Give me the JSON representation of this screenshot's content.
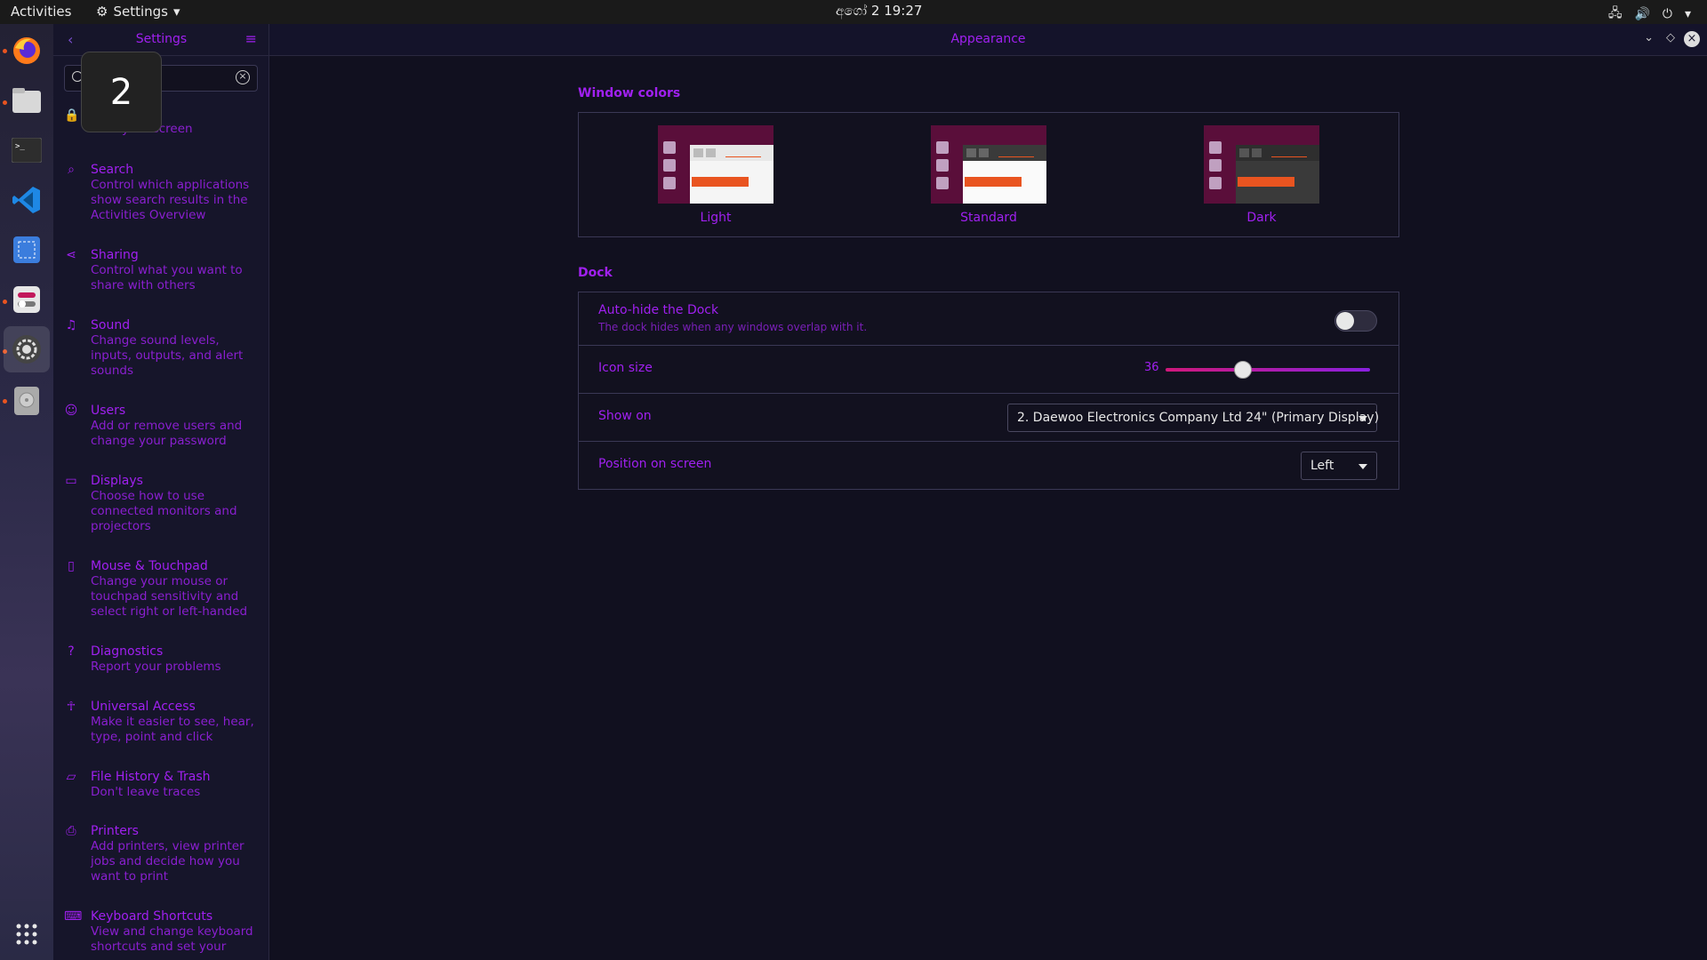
{
  "topbar": {
    "activities": "Activities",
    "app_menu": "Settings",
    "clock": "අගෝ  2  19:27"
  },
  "overlay": {
    "number": "2"
  },
  "sidebar": {
    "title": "Settings",
    "search_placeholder": "",
    "items": [
      {
        "title": "",
        "desc": "Lock your screen",
        "icon": "lock-icon"
      },
      {
        "title": "Search",
        "desc": "Control which applications show search results in the Activities Overview",
        "icon": "search-icon"
      },
      {
        "title": "Sharing",
        "desc": "Control what you want to share with others",
        "icon": "share-icon"
      },
      {
        "title": "Sound",
        "desc": "Change sound levels, inputs, outputs, and alert sounds",
        "icon": "music-note-icon"
      },
      {
        "title": "Users",
        "desc": "Add or remove users and change your password",
        "icon": "user-icon"
      },
      {
        "title": "Displays",
        "desc": "Choose how to use connected monitors and projectors",
        "icon": "display-icon"
      },
      {
        "title": "Mouse & Touchpad",
        "desc": "Change your mouse or touchpad sensitivity and select right or left-handed",
        "icon": "mouse-icon"
      },
      {
        "title": "Diagnostics",
        "desc": "Report your problems",
        "icon": "help-icon"
      },
      {
        "title": "Universal Access",
        "desc": "Make it easier to see, hear, type, point and click",
        "icon": "accessibility-icon"
      },
      {
        "title": "File History & Trash",
        "desc": "Don't leave traces",
        "icon": "folder-icon"
      },
      {
        "title": "Printers",
        "desc": "Add printers, view printer jobs and decide how you want to print",
        "icon": "printer-icon"
      },
      {
        "title": "Keyboard Shortcuts",
        "desc": "View and change keyboard shortcuts and set your",
        "icon": "keyboard-icon"
      }
    ]
  },
  "main": {
    "title": "Appearance",
    "window_colors": {
      "heading": "Window colors",
      "themes": [
        {
          "label": "Light"
        },
        {
          "label": "Standard"
        },
        {
          "label": "Dark"
        }
      ]
    },
    "dock": {
      "heading": "Dock",
      "autohide_label": "Auto-hide the Dock",
      "autohide_desc": "The dock hides when any windows overlap with it.",
      "autohide_on": false,
      "icon_size_label": "Icon size",
      "icon_size_value": "36",
      "icon_size_fraction": 0.38,
      "show_on_label": "Show on",
      "show_on_value": "2. Daewoo Electronics Company Ltd 24\" (Primary Display)",
      "position_label": "Position on screen",
      "position_value": "Left"
    }
  },
  "colors": {
    "accent": "#a020f0",
    "orange": "#e95420",
    "aubergine": "#5a0e3a"
  }
}
